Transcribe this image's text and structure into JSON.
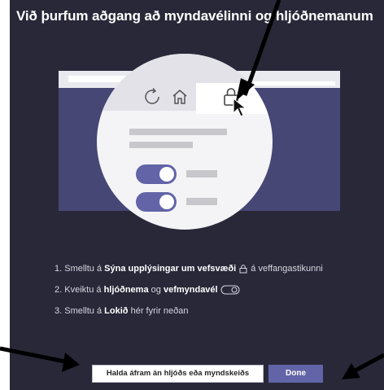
{
  "dialog": {
    "title": "Við þurfum aðgang að myndavélinni og hljóðnemanum"
  },
  "illustration": {
    "icons": [
      "refresh-icon",
      "home-icon",
      "lock-icon",
      "cursor-icon"
    ],
    "toggles_on": [
      1,
      1
    ]
  },
  "steps": [
    {
      "number": "1.",
      "prefix": "Smelltu á",
      "bold": "Sýna upplýsingar um vefsvæði",
      "icon": "lock-icon",
      "suffix": "á veffangastikunni"
    },
    {
      "number": "2.",
      "prefix": "Kveiktu á",
      "bold": "hljóðnema",
      "middle": "og",
      "bold2": "vefmyndavél",
      "icon": "toggle-icon"
    },
    {
      "number": "3.",
      "prefix": "Smelltu á",
      "bold": "Lokið",
      "suffix": "hér fyrir neðan"
    }
  ],
  "buttons": {
    "continue_without": "Halda áfram án hljóðs eða myndskeiðs",
    "done": "Done"
  },
  "annotations": {
    "arrows": [
      "arrow-to-lock",
      "arrow-to-continue-button",
      "arrow-to-done-button"
    ]
  },
  "colors": {
    "dialog_bg": "#292839",
    "accent": "#6264a7",
    "browser_bg": "#464775"
  }
}
